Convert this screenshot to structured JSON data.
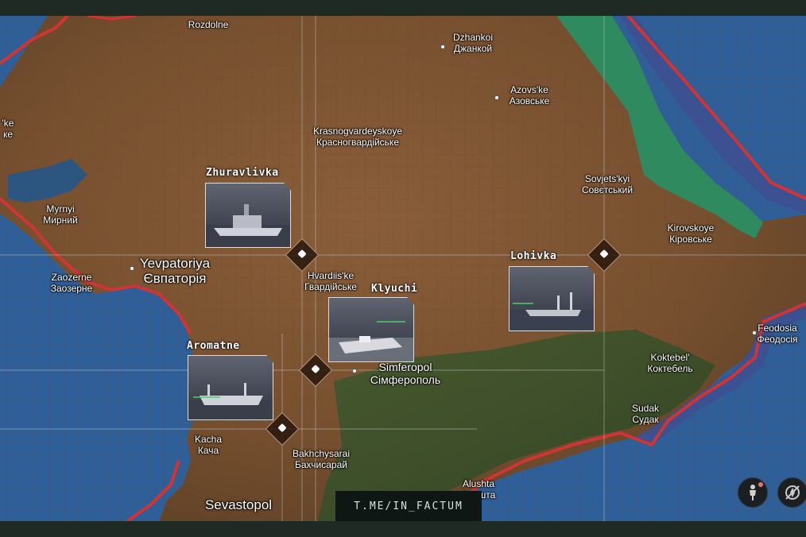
{
  "colors": {
    "land": "#7a5233",
    "sea": "#2f5f98",
    "lagoon": "#2f8a5f",
    "buffer": "#3e4f8f",
    "border": "#d13434",
    "grid": "#d8d8d8"
  },
  "watermark": "T.ME/IN_FACTUM",
  "controls": {
    "pegman_icon": "pegman-icon",
    "compass_icon": "compass-reset-icon"
  },
  "targets": [
    {
      "name": "Zhuravlivka"
    },
    {
      "name": "Lohivka"
    },
    {
      "name": "Klyuchi"
    },
    {
      "name": "Aromatne"
    }
  ],
  "places": [
    {
      "en": "Rozdolne",
      "local": ""
    },
    {
      "en": "Dzhankoi",
      "local": "Джанкой"
    },
    {
      "en": "Azovs'ke",
      "local": "Азовське"
    },
    {
      "en": "Krasnogvardeyskoye",
      "local": "Красногвардійське"
    },
    {
      "en": "Sovjets'kyi",
      "local": "Совєтський"
    },
    {
      "en": "Kirovskoye",
      "local": "Кіровське"
    },
    {
      "en": "Myrnyi",
      "local": "Мирний"
    },
    {
      "en": "Yevpatoriya",
      "local": "Євпаторія"
    },
    {
      "en": "Zaozerne",
      "local": "Заозерне"
    },
    {
      "en": "Hvardiis'ke",
      "local": "Гвардійське"
    },
    {
      "en": "Simferopol",
      "local": "Сімферополь"
    },
    {
      "en": "Feodosia",
      "local": "Феодосія"
    },
    {
      "en": "Koktebel'",
      "local": "Коктебель"
    },
    {
      "en": "Sudak",
      "local": "Судак"
    },
    {
      "en": "Kacha",
      "local": "Кача"
    },
    {
      "en": "Bakhchysarai",
      "local": "Бахчисарай"
    },
    {
      "en": "Sevastopol",
      "local": ""
    },
    {
      "en": "Alushta",
      "local": "Алушта"
    },
    {
      "en": "'ke",
      "local": "ке"
    }
  ]
}
